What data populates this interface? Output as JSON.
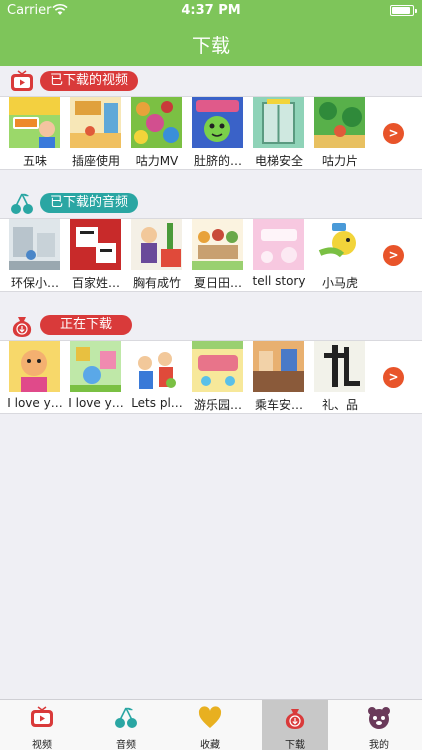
{
  "status_bar": {
    "carrier": "Carrier",
    "time": "4:37 PM",
    "battery_fraction": 0.9
  },
  "header": {
    "title": "下载"
  },
  "sections": [
    {
      "label": "已下载的视频",
      "icon": "tv-icon",
      "pill_color": "#d93a3a",
      "items": [
        "五味",
        "插座使用",
        "咕力MV",
        "肚脐的…",
        "电梯安全",
        "咕力片"
      ]
    },
    {
      "label": "已下载的音频",
      "icon": "cherries-icon",
      "pill_color": "#2aa6a3",
      "items": [
        "环保小…",
        "百家姓…",
        "胸有成竹",
        "夏日田…",
        "tell story",
        "小马虎"
      ]
    },
    {
      "label": "正在下载",
      "icon": "download-bag-icon",
      "pill_color": "#d93a3a",
      "items": [
        "I love y…",
        "I love y…",
        "Lets pl…",
        "游乐园…",
        "乘车安…",
        "礼、品"
      ]
    }
  ],
  "more_button_symbol": ">",
  "tabbar": {
    "active_index": 3,
    "tabs": [
      {
        "label": "视频",
        "icon": "tv-icon"
      },
      {
        "label": "音频",
        "icon": "cherries-icon"
      },
      {
        "label": "收藏",
        "icon": "heart-icon"
      },
      {
        "label": "下载",
        "icon": "download-bag-icon"
      },
      {
        "label": "我的",
        "icon": "bear-face-icon"
      }
    ]
  }
}
